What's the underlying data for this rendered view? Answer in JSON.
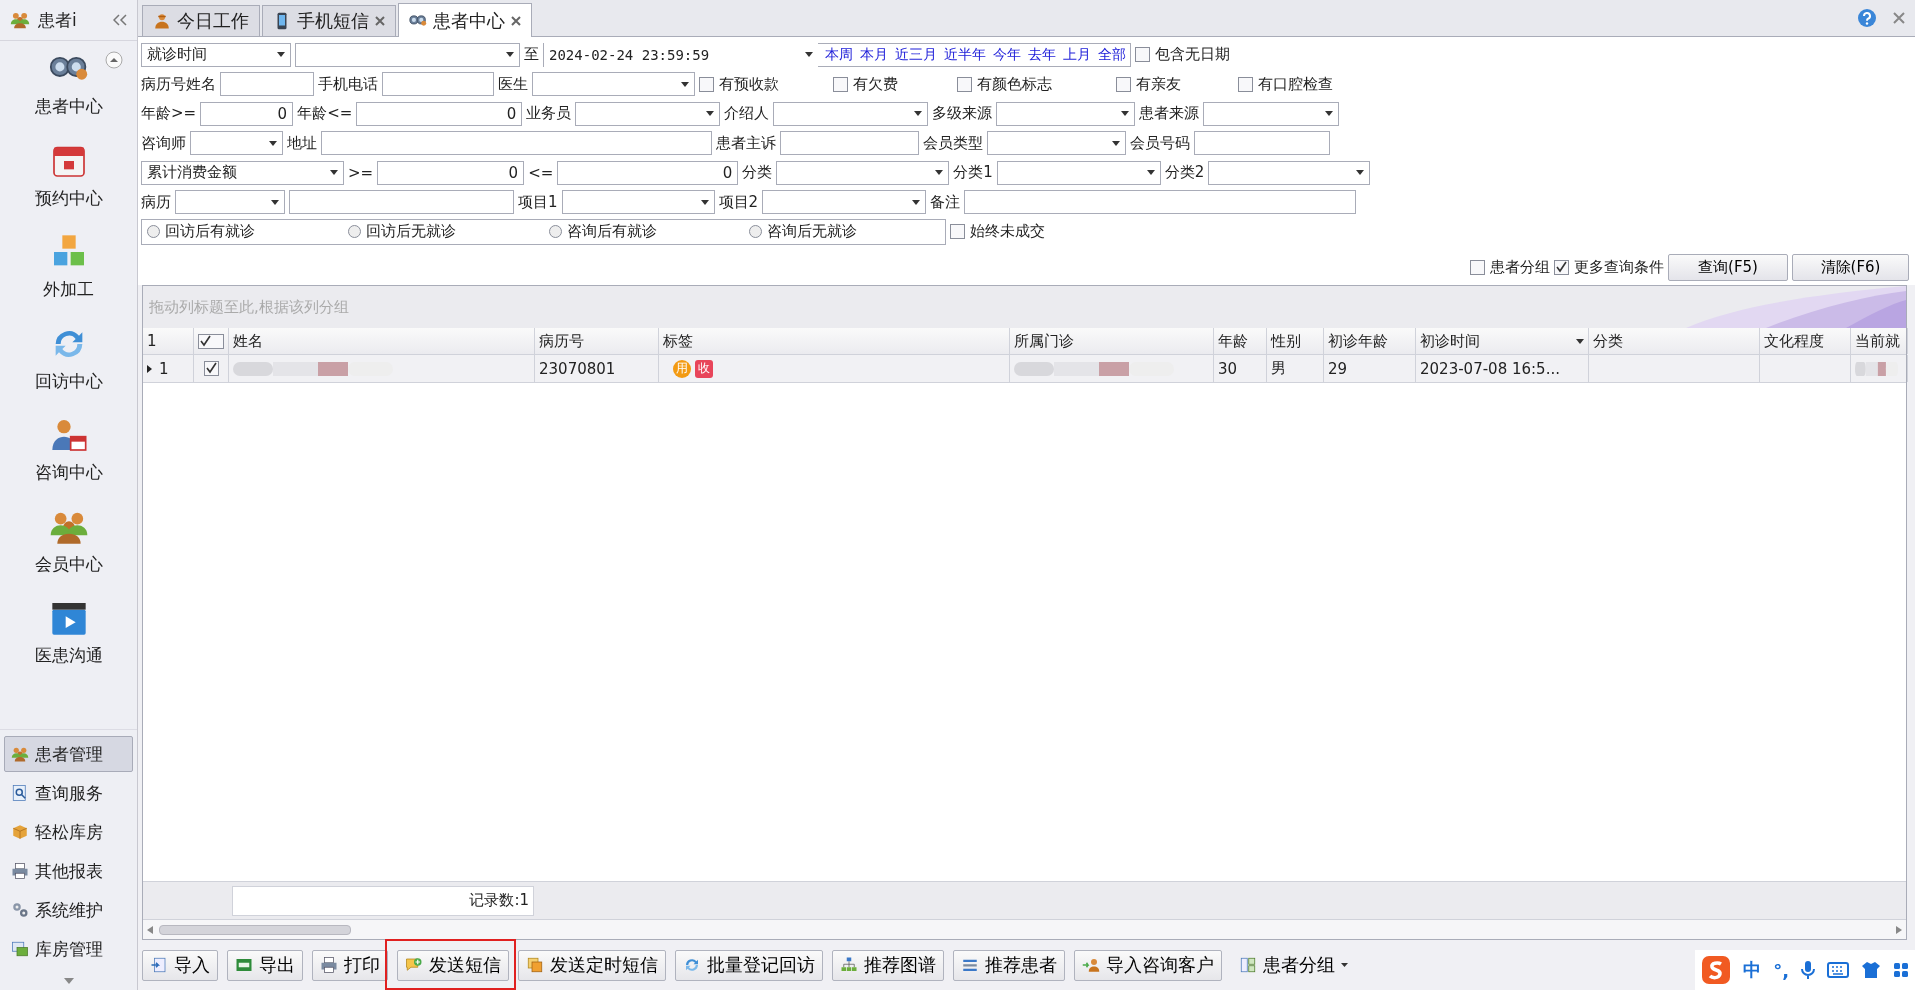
{
  "sidebar": {
    "title": "患者i",
    "modules": [
      {
        "label": "患者中心",
        "kind": "binoculars"
      },
      {
        "label": "预约中心",
        "kind": "calendar"
      },
      {
        "label": "外加工",
        "kind": "cubes"
      },
      {
        "label": "回访中心",
        "kind": "refresh"
      },
      {
        "label": "咨询中心",
        "kind": "person-calendar"
      },
      {
        "label": "会员中心",
        "kind": "people"
      },
      {
        "label": "医患沟通",
        "kind": "video"
      }
    ],
    "sections": [
      {
        "label": "患者管理",
        "kind": "people",
        "selected": true
      },
      {
        "label": "查询服务",
        "kind": "search",
        "selected": false
      },
      {
        "label": "轻松库房",
        "kind": "box",
        "selected": false
      },
      {
        "label": "其他报表",
        "kind": "printer",
        "selected": false
      },
      {
        "label": "系统维护",
        "kind": "gears",
        "selected": false
      },
      {
        "label": "库房管理",
        "kind": "stack",
        "selected": false
      }
    ]
  },
  "tabs": [
    {
      "label": "今日工作",
      "kind": "worker",
      "closable": false,
      "selected": false
    },
    {
      "label": "手机短信",
      "kind": "phone",
      "closable": true,
      "selected": false
    },
    {
      "label": "患者中心",
      "kind": "binoculars",
      "closable": true,
      "selected": true
    }
  ],
  "filters": [
    [
      {
        "kind": "select",
        "value": "就诊时间"
      },
      {
        "kind": "select"
      },
      {
        "kind": "label",
        "text": "至"
      },
      {
        "kind": "date",
        "value": "2024-02-24 23:59:59",
        "links": [
          "本周",
          "本月",
          "近三月",
          "近半年",
          "今年",
          "去年",
          "上月",
          "全部"
        ]
      },
      {
        "kind": "checkbox",
        "label": "包含无日期",
        "checked": false
      }
    ],
    [
      {
        "kind": "label",
        "text": "病历号姓名"
      },
      {
        "kind": "input"
      },
      {
        "kind": "label",
        "text": "手机电话"
      },
      {
        "kind": "input"
      },
      {
        "kind": "label",
        "text": "医生"
      },
      {
        "kind": "select"
      },
      {
        "kind": "checkbox",
        "label": "有预收款",
        "checked": false
      },
      {
        "kind": "checkbox",
        "label": "有欠费",
        "checked": false
      },
      {
        "kind": "checkbox",
        "label": "有颜色标志",
        "checked": false
      },
      {
        "kind": "checkbox",
        "label": "有亲友",
        "checked": false
      },
      {
        "kind": "checkbox",
        "label": "有口腔检查",
        "checked": false
      }
    ],
    [
      {
        "kind": "label",
        "text": "年龄>="
      },
      {
        "kind": "number",
        "value": "0"
      },
      {
        "kind": "label",
        "text": "年龄<="
      },
      {
        "kind": "number",
        "value": "0"
      },
      {
        "kind": "label",
        "text": "业务员"
      },
      {
        "kind": "select"
      },
      {
        "kind": "label",
        "text": "介绍人"
      },
      {
        "kind": "select"
      },
      {
        "kind": "label",
        "text": "多级来源"
      },
      {
        "kind": "select"
      },
      {
        "kind": "label",
        "text": "患者来源"
      },
      {
        "kind": "select"
      }
    ],
    [
      {
        "kind": "label",
        "text": "咨询师"
      },
      {
        "kind": "select"
      },
      {
        "kind": "label",
        "text": "地址"
      },
      {
        "kind": "input"
      },
      {
        "kind": "label",
        "text": "患者主诉"
      },
      {
        "kind": "input"
      },
      {
        "kind": "label",
        "text": "会员类型"
      },
      {
        "kind": "select"
      },
      {
        "kind": "label",
        "text": "会员号码"
      },
      {
        "kind": "input"
      }
    ],
    [
      {
        "kind": "select",
        "value": "累计消费金额"
      },
      {
        "kind": "label",
        "text": ">="
      },
      {
        "kind": "number",
        "value": "0"
      },
      {
        "kind": "label",
        "text": "<="
      },
      {
        "kind": "number",
        "value": "0"
      },
      {
        "kind": "label",
        "text": "分类"
      },
      {
        "kind": "select"
      },
      {
        "kind": "label",
        "text": "分类1"
      },
      {
        "kind": "select"
      },
      {
        "kind": "label",
        "text": "分类2"
      },
      {
        "kind": "select"
      }
    ],
    [
      {
        "kind": "label",
        "text": "病历"
      },
      {
        "kind": "select"
      },
      {
        "kind": "input"
      },
      {
        "kind": "label",
        "text": "项目1"
      },
      {
        "kind": "select"
      },
      {
        "kind": "label",
        "text": "项目2"
      },
      {
        "kind": "select"
      },
      {
        "kind": "label",
        "text": "备注"
      },
      {
        "kind": "input"
      }
    ],
    [
      {
        "kind": "radios",
        "options": [
          {
            "label": "回访后有就诊",
            "selected": false
          },
          {
            "label": "回访后无就诊",
            "selected": false
          },
          {
            "label": "咨询后有就诊",
            "selected": false
          },
          {
            "label": "咨询后无就诊",
            "selected": false
          }
        ]
      },
      {
        "kind": "checkbox",
        "label": "始终未成交",
        "checked": false
      }
    ],
    [
      {
        "kind": "checkbox",
        "label": "患者分组",
        "checked": false
      },
      {
        "kind": "checkbox",
        "label": "更多查询条件",
        "checked": true
      },
      {
        "kind": "button",
        "label": "查询(F5)"
      },
      {
        "kind": "button",
        "label": "清除(F6)"
      }
    ]
  ],
  "grid": {
    "group_hint": "拖动列标题至此,根据该列分组",
    "header_number": "1",
    "header_checked": true,
    "columns": [
      {
        "label": "姓名",
        "filter": false
      },
      {
        "label": "病历号",
        "filter": false
      },
      {
        "label": "标签",
        "filter": false
      },
      {
        "label": "所属门诊",
        "filter": false
      },
      {
        "label": "年龄",
        "filter": false
      },
      {
        "label": "性别",
        "filter": false
      },
      {
        "label": "初诊年龄",
        "filter": false
      },
      {
        "label": "初诊时间",
        "filter": true
      },
      {
        "label": "分类",
        "filter": false
      },
      {
        "label": "文化程度",
        "filter": false
      },
      {
        "label": "当前就",
        "filter": false
      }
    ],
    "rows": [
      {
        "number": "1",
        "checked": true,
        "current": true,
        "cells": [
          {
            "kind": "blurred"
          },
          {
            "kind": "text",
            "text": "23070801"
          },
          {
            "kind": "tags",
            "tags": [
              {
                "text": "用",
                "kind": "circle",
                "color": "#f39a12"
              },
              {
                "text": "收",
                "kind": "square",
                "color": "#e8455a"
              }
            ]
          },
          {
            "kind": "blurred"
          },
          {
            "kind": "text",
            "text": "30"
          },
          {
            "kind": "text",
            "text": "男"
          },
          {
            "kind": "text",
            "text": "29"
          },
          {
            "kind": "text",
            "text": "2023-07-08 16:5..."
          },
          {
            "kind": "empty"
          },
          {
            "kind": "empty"
          },
          {
            "kind": "blurred"
          }
        ]
      }
    ],
    "footer": "记录数:1"
  },
  "toolbar": [
    {
      "label": "导入",
      "kind": "import",
      "highlighted": false
    },
    {
      "label": "导出",
      "kind": "xls",
      "highlighted": false
    },
    {
      "label": "打印",
      "kind": "printer",
      "highlighted": false
    },
    {
      "label": "发送短信",
      "kind": "chat",
      "highlighted": true
    },
    {
      "label": "发送定时短信",
      "kind": "pages",
      "highlighted": false
    },
    {
      "label": "批量登记回访",
      "kind": "refresh",
      "highlighted": false
    },
    {
      "label": "推荐图谱",
      "kind": "tree",
      "highlighted": false
    },
    {
      "label": "推荐患者",
      "kind": "lines",
      "highlighted": false
    },
    {
      "label": "导入咨询客户",
      "kind": "person-arrow",
      "highlighted": false
    },
    {
      "label": "患者分组",
      "kind": "menu",
      "highlighted": false
    }
  ],
  "ime": {
    "mode": "中",
    "punct": "°,"
  }
}
